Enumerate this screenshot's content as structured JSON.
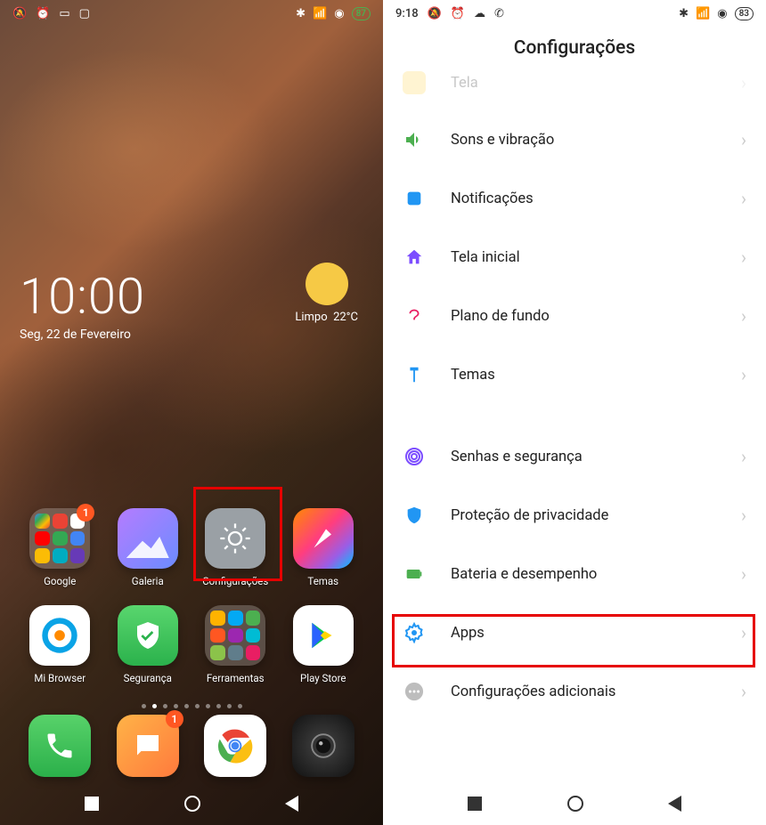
{
  "left": {
    "status": {
      "battery": "87"
    },
    "clock": {
      "time": "10:00",
      "date": "Seg, 22 de Fevereiro"
    },
    "weather": {
      "condition": "Limpo",
      "temp": "22°C"
    },
    "row1": {
      "google": {
        "label": "Google",
        "badge": "1"
      },
      "galeria": {
        "label": "Galeria"
      },
      "config": {
        "label": "Configurações"
      },
      "temas": {
        "label": "Temas"
      }
    },
    "row2": {
      "browser": {
        "label": "Mi Browser"
      },
      "seguranca": {
        "label": "Segurança"
      },
      "ferramentas": {
        "label": "Ferramentas"
      },
      "playstore": {
        "label": "Play Store"
      }
    },
    "dock": {
      "msg_badge": "1"
    }
  },
  "right": {
    "status": {
      "time": "9:18",
      "battery": "83"
    },
    "title": "Configurações",
    "items": {
      "tela": "Tela",
      "sons": "Sons e vibração",
      "notif": "Notificações",
      "telainicial": "Tela inicial",
      "plano": "Plano de fundo",
      "temas": "Temas",
      "senhas": "Senhas e segurança",
      "privacidade": "Proteção de privacidade",
      "bateria": "Bateria e desempenho",
      "apps": "Apps",
      "config_adic": "Configurações adicionais"
    }
  }
}
